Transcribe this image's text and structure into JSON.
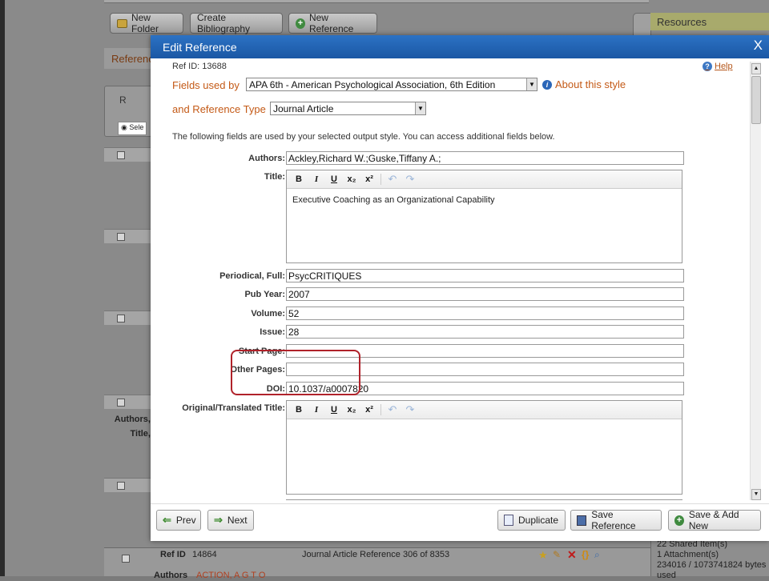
{
  "background": {
    "toolbar": {
      "new_folder": "New Folder",
      "create_bibliography": "Create Bibliography",
      "new_reference": "New Reference"
    },
    "references_tab": "Reference",
    "panel_letter": "R",
    "select_text": "Sele",
    "row_labels": {
      "authors": "Authors,",
      "title": "Title,"
    },
    "resources_label": "Resources",
    "bottom_row": {
      "ref_id_label": "Ref ID",
      "ref_id": "14864",
      "description": "Journal Article Reference 306 of 8353",
      "authors_label": "Authors",
      "authors_value": "ACTION, A G T O"
    },
    "status": {
      "shared_items": "22 Shared Item(s)",
      "attachments": "1 Attachment(s)",
      "bytes": "234016 / 1073741824 bytes",
      "used": "used"
    }
  },
  "modal": {
    "title": "Edit Reference",
    "close": "X",
    "ref_id": "Ref ID: 13688",
    "help": "Help",
    "fields_used_by_label": "Fields used by",
    "output_style": "APA 6th - American Psychological Association, 6th Edition",
    "about_style": "About this style",
    "reference_type_label": "and Reference Type",
    "reference_type": "Journal Article",
    "note": "The following fields are used by your selected output style. You can access additional fields below.",
    "fields": {
      "authors": {
        "label": "Authors:",
        "value": "Ackley,Richard W.;Guske,Tiffany A.;"
      },
      "title": {
        "label": "Title:",
        "value": "Executive Coaching as an Organizational Capability"
      },
      "periodical": {
        "label": "Periodical, Full:",
        "value": "PsycCRITIQUES"
      },
      "pub_year": {
        "label": "Pub Year:",
        "value": "2007"
      },
      "volume": {
        "label": "Volume:",
        "value": "52"
      },
      "issue": {
        "label": "Issue:",
        "value": "28"
      },
      "start_page": {
        "label": "Start Page:",
        "value": ""
      },
      "other_pages": {
        "label": "Other Pages:",
        "value": ""
      },
      "doi": {
        "label": "DOI:",
        "value": "10.1037/a0007820"
      },
      "original_title": {
        "label": "Original/Translated Title:",
        "value": ""
      }
    },
    "editor_toolbar": {
      "bold": "B",
      "italic": "I",
      "underline": "U",
      "subscript": "x₂",
      "superscript": "x²",
      "undo": "↶",
      "redo": "↷"
    },
    "footer": {
      "prev": "Prev",
      "next": "Next",
      "duplicate": "Duplicate",
      "save_reference": "Save Reference",
      "save_add_new": "Save & Add New"
    }
  },
  "colors": {
    "header_blue": "#1f5fae",
    "label_orange": "#c45a17",
    "highlight_red": "#b0222a"
  }
}
